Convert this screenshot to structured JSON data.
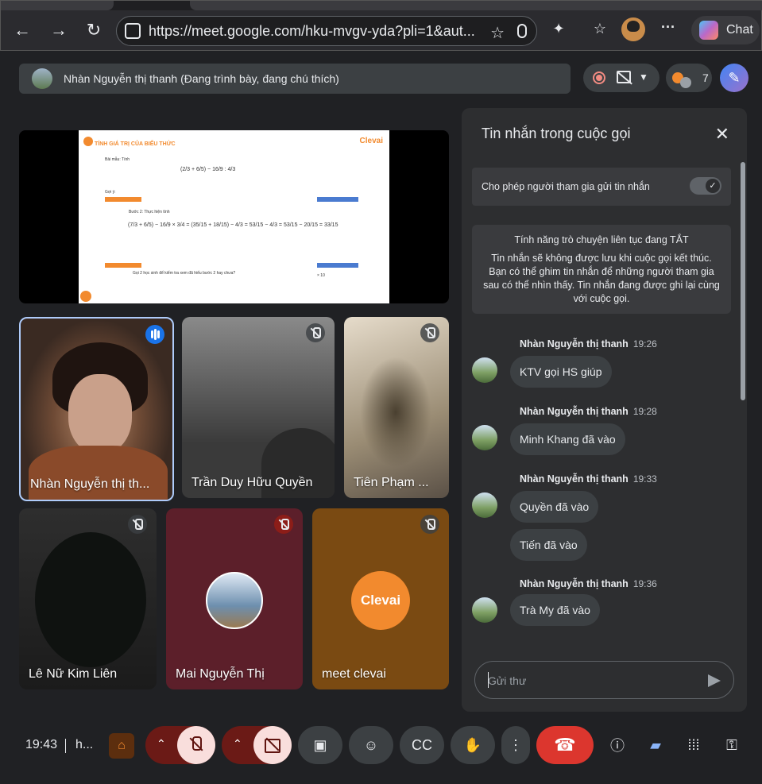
{
  "browser": {
    "url": "https://meet.google.com/hku-mvgv-yda?pli=1&aut...",
    "chat_label": "Chat"
  },
  "meet": {
    "presenting_text": "Nhàn Nguyễn thị thanh (Đang trình bày, đang chú thích)",
    "participant_count": "7"
  },
  "slide": {
    "title": "TÍNH GIÁ TRỊ CỦA BIỂU THỨC",
    "brand": "Clevai",
    "l1": "Bài mẫu: Tính",
    "f1": "(2/3 + 6/5) − 16/9 : 4/3",
    "l2": "Gợi ý:",
    "l3": "Bước 2: Thực hiện tính",
    "f2": "(7/3 + 6/5) − 16/9 × 3/4 = (35/15 + 18/15) − 4/3 = 53/15 − 4/3 = 53/15 − 20/15 = 33/15",
    "l4": "Gọi 2 học sinh để kiểm tra xem đã hiểu bước 2 hay chưa?",
    "l5": "× 10"
  },
  "participants": [
    {
      "name": "Nhàn Nguyễn thị th...",
      "state": "speaking"
    },
    {
      "name": "Trần Duy Hữu Quyền",
      "state": "muted"
    },
    {
      "name": "Tiên Phạm ...",
      "state": "muted"
    },
    {
      "name": "Lê Nữ Kim Liên",
      "state": "muted"
    },
    {
      "name": "Mai Nguyễn Thị",
      "state": "muted-red"
    },
    {
      "name": "meet clevai",
      "state": "muted",
      "logo": "Clevai"
    }
  ],
  "chat": {
    "title": "Tin nhắn trong cuộc gọi",
    "allow_label": "Cho phép người tham gia gửi tin nhắn",
    "info_heading": "Tính năng trò chuyện liên tục đang TẮT",
    "info_body": "Tin nhắn sẽ không được lưu khi cuộc gọi kết thúc. Bạn có thể ghim tin nhắn để những người tham gia sau có thể nhìn thấy. Tin nhắn đang được ghi lại cùng với cuộc gọi.",
    "messages": [
      {
        "sender": "Nhàn Nguyễn thị thanh",
        "time": "19:26",
        "texts": [
          "KTV gọi HS giúp"
        ]
      },
      {
        "sender": "Nhàn Nguyễn thị thanh",
        "time": "19:28",
        "texts": [
          "Minh Khang đã vào"
        ]
      },
      {
        "sender": "Nhàn Nguyễn thị thanh",
        "time": "19:33",
        "texts": [
          "Quyền đã vào",
          "Tiến đã vào"
        ]
      },
      {
        "sender": "Nhàn Nguyễn thị thanh",
        "time": "19:36",
        "texts": [
          "Trà My đã vào"
        ]
      }
    ],
    "send_placeholder": "Gửi thư"
  },
  "toolbar": {
    "time": "19:43",
    "meeting_code": "h..."
  },
  "colors": {
    "accent": "#8ab4f8",
    "hangup": "#dc362e",
    "muted_bg": "#f9dedc",
    "brand": "#f28a2e"
  }
}
